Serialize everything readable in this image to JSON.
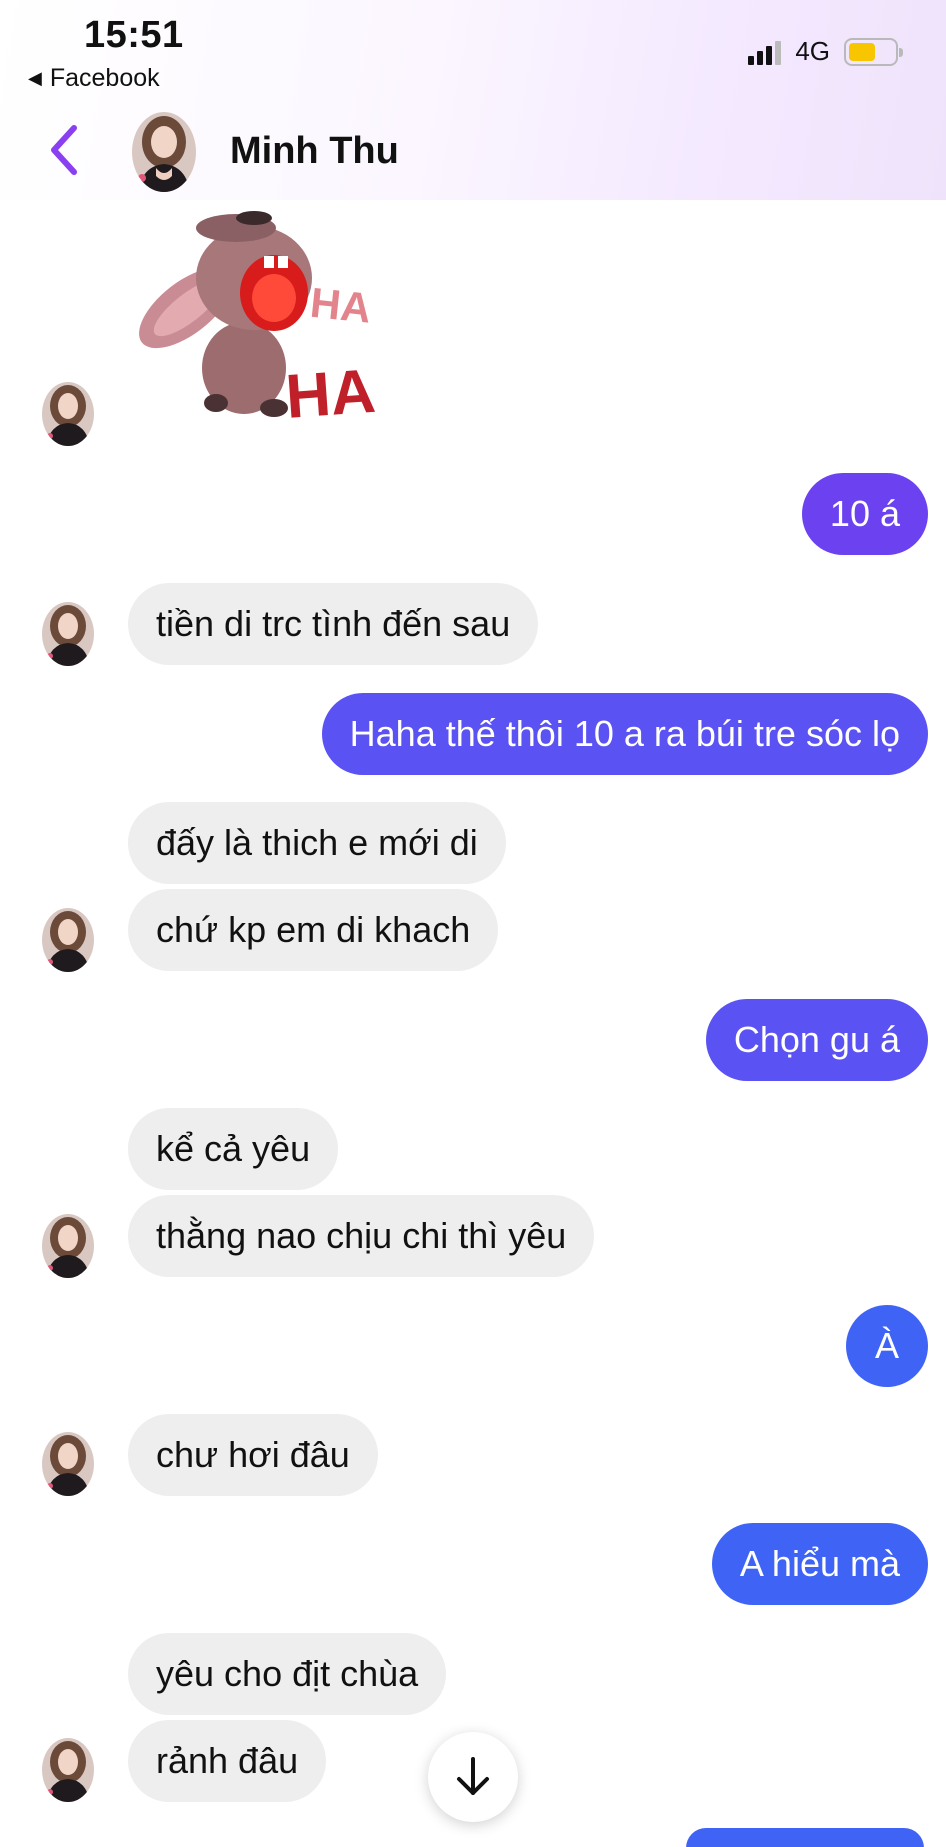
{
  "status_bar": {
    "time": "15:51",
    "back_app": "Facebook",
    "network": "4G"
  },
  "header": {
    "contact_name": "Minh Thu"
  },
  "sticker": {
    "top_text": "HA",
    "bottom_text": "HA"
  },
  "messages": [
    {
      "from": "me",
      "text": "10 á"
    },
    {
      "from": "them",
      "text": "tiền di trc tình đến sau"
    },
    {
      "from": "me",
      "text": "Haha thế thôi 10 a ra búi tre sóc lọ"
    },
    {
      "from": "them",
      "text": "đấy là thich e mới di"
    },
    {
      "from": "them",
      "text": "chứ kp em di khach"
    },
    {
      "from": "me",
      "text": "Chọn gu á"
    },
    {
      "from": "them",
      "text": "kể cả yêu"
    },
    {
      "from": "them",
      "text": "thằng nao chịu chi thì yêu"
    },
    {
      "from": "me",
      "text": "À"
    },
    {
      "from": "them",
      "text": "chư hơi đâu"
    },
    {
      "from": "me",
      "text": "A hiểu mà"
    },
    {
      "from": "them",
      "text": "yêu cho địt chùa"
    },
    {
      "from": "them",
      "text": "rảnh đâu"
    }
  ],
  "colors": {
    "bubble_in": "#eeeeef",
    "bubble_out_purple": "#6c42f0",
    "bubble_out_violet": "#5a52f2",
    "bubble_out_blue": "#3f64f5",
    "back_chevron": "#8a3ff0",
    "battery": "#f7c600"
  },
  "icons": {
    "back": "chevron-left-icon",
    "scroll": "arrow-down-icon"
  }
}
